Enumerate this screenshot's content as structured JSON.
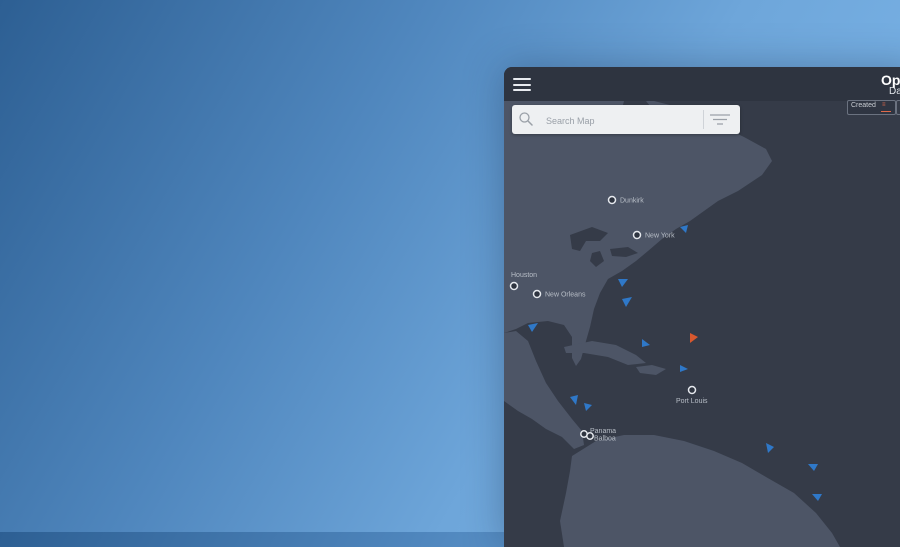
{
  "window": {
    "title": "Op",
    "subtitle": "Da"
  },
  "search": {
    "placeholder": "Search Map",
    "icon": "search-icon",
    "filter_icon": "filter-icon"
  },
  "sort": {
    "label": "Created",
    "direction_glyph": "≡",
    "indicator_color": "#e06a4a"
  },
  "map": {
    "ports": [
      "Dunkirk",
      "New York",
      "Houston",
      "New Orleans",
      "Port Louis",
      "Panama",
      "Balboa"
    ],
    "vessel_color": "#2f78c8",
    "alert_vessel_color": "#d8582e"
  }
}
